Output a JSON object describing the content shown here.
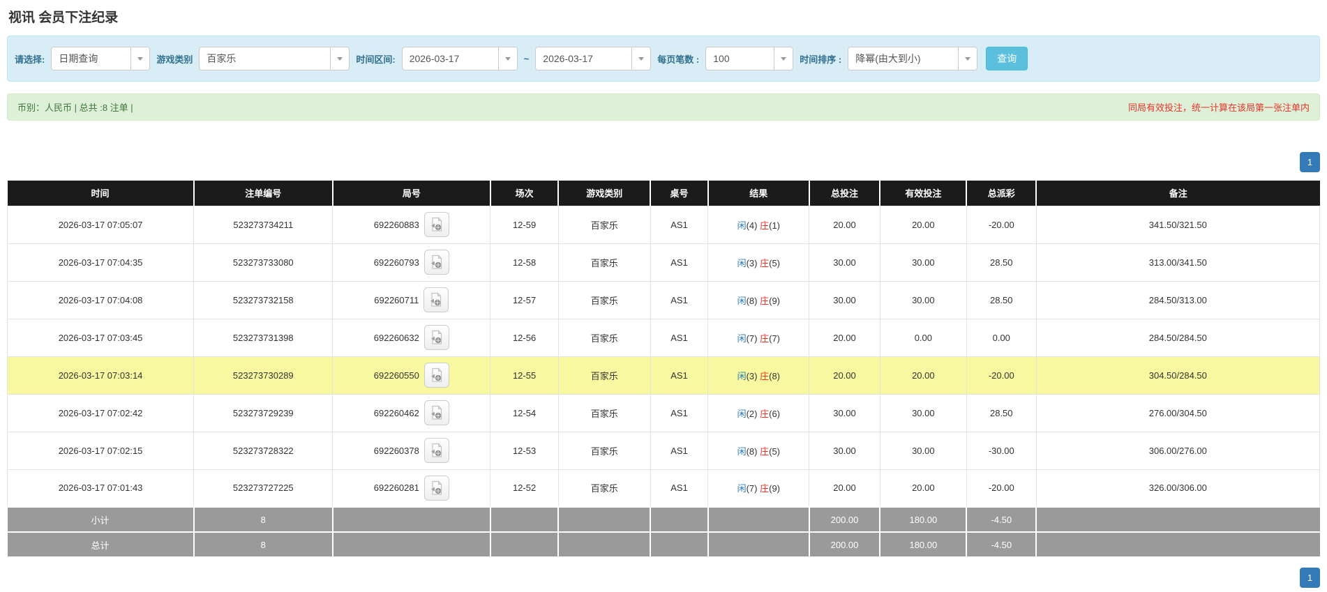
{
  "page_title": "视讯 会员下注纪录",
  "filters": {
    "select_label": "请选择:",
    "select_value": "日期查询",
    "game_type_label": "游戏类别",
    "game_type_value": "百家乐",
    "date_range_label": "时间区间:",
    "date_from": "2026-03-17",
    "date_sep": "~",
    "date_to": "2026-03-17",
    "page_size_label": "每页笔数 :",
    "page_size_value": "100",
    "sort_label": "时间排序 :",
    "sort_value": "降幂(由大到小)",
    "search_button": "查询"
  },
  "info_bar": {
    "left": "币别：人民币 | 总共 :8 注单 |",
    "right": "同局有效投注，统一计算在该局第一张注单内"
  },
  "pagination": {
    "page": "1"
  },
  "table": {
    "headers": [
      "时间",
      "注单编号",
      "局号",
      "场次",
      "游戏类别",
      "桌号",
      "结果",
      "总投注",
      "有效投注",
      "总派彩",
      "备注"
    ],
    "rows": [
      {
        "time": "2026-03-17 07:05:07",
        "bet_id": "523273734211",
        "round_id": "692260883",
        "session": "12-59",
        "game_type": "百家乐",
        "table_no": "AS1",
        "player": "闲",
        "player_score": "(4)",
        "banker": "庄",
        "banker_score": "(1)",
        "total_bet": "20.00",
        "valid_bet": "20.00",
        "payout": "-20.00",
        "remark": "341.50/321.50",
        "highlighted": false
      },
      {
        "time": "2026-03-17 07:04:35",
        "bet_id": "523273733080",
        "round_id": "692260793",
        "session": "12-58",
        "game_type": "百家乐",
        "table_no": "AS1",
        "player": "闲",
        "player_score": "(3)",
        "banker": "庄",
        "banker_score": "(5)",
        "total_bet": "30.00",
        "valid_bet": "30.00",
        "payout": "28.50",
        "remark": "313.00/341.50",
        "highlighted": false
      },
      {
        "time": "2026-03-17 07:04:08",
        "bet_id": "523273732158",
        "round_id": "692260711",
        "session": "12-57",
        "game_type": "百家乐",
        "table_no": "AS1",
        "player": "闲",
        "player_score": "(8)",
        "banker": "庄",
        "banker_score": "(9)",
        "total_bet": "30.00",
        "valid_bet": "30.00",
        "payout": "28.50",
        "remark": "284.50/313.00",
        "highlighted": false
      },
      {
        "time": "2026-03-17 07:03:45",
        "bet_id": "523273731398",
        "round_id": "692260632",
        "session": "12-56",
        "game_type": "百家乐",
        "table_no": "AS1",
        "player": "闲",
        "player_score": "(7)",
        "banker": "庄",
        "banker_score": "(7)",
        "total_bet": "20.00",
        "valid_bet": "0.00",
        "payout": "0.00",
        "remark": "284.50/284.50",
        "highlighted": false
      },
      {
        "time": "2026-03-17 07:03:14",
        "bet_id": "523273730289",
        "round_id": "692260550",
        "session": "12-55",
        "game_type": "百家乐",
        "table_no": "AS1",
        "player": "闲",
        "player_score": "(3)",
        "banker": "庄",
        "banker_score": "(8)",
        "total_bet": "20.00",
        "valid_bet": "20.00",
        "payout": "-20.00",
        "remark": "304.50/284.50",
        "highlighted": true
      },
      {
        "time": "2026-03-17 07:02:42",
        "bet_id": "523273729239",
        "round_id": "692260462",
        "session": "12-54",
        "game_type": "百家乐",
        "table_no": "AS1",
        "player": "闲",
        "player_score": "(2)",
        "banker": "庄",
        "banker_score": "(6)",
        "total_bet": "30.00",
        "valid_bet": "30.00",
        "payout": "28.50",
        "remark": "276.00/304.50",
        "highlighted": false
      },
      {
        "time": "2026-03-17 07:02:15",
        "bet_id": "523273728322",
        "round_id": "692260378",
        "session": "12-53",
        "game_type": "百家乐",
        "table_no": "AS1",
        "player": "闲",
        "player_score": "(8)",
        "banker": "庄",
        "banker_score": "(5)",
        "total_bet": "30.00",
        "valid_bet": "30.00",
        "payout": "-30.00",
        "remark": "306.00/276.00",
        "highlighted": false
      },
      {
        "time": "2026-03-17 07:01:43",
        "bet_id": "523273727225",
        "round_id": "692260281",
        "session": "12-52",
        "game_type": "百家乐",
        "table_no": "AS1",
        "player": "闲",
        "player_score": "(7)",
        "banker": "庄",
        "banker_score": "(9)",
        "total_bet": "20.00",
        "valid_bet": "20.00",
        "payout": "-20.00",
        "remark": "326.00/306.00",
        "highlighted": false
      }
    ],
    "footer_rows": [
      {
        "label": "小计",
        "count": "8",
        "total_bet": "200.00",
        "valid_bet": "180.00",
        "payout": "-4.50"
      },
      {
        "label": "总计",
        "count": "8",
        "total_bet": "200.00",
        "valid_bet": "180.00",
        "payout": "-4.50"
      }
    ]
  },
  "icons": {
    "video_file": "video-file-icon",
    "dropdown": "chevron-down-icon"
  },
  "colors": {
    "panel_bg": "#d9edf7",
    "panel_border": "#bce8f1",
    "label_blue": "#31708f",
    "button_blue": "#5bc0de",
    "info_bg": "#dff0d8",
    "info_text_green": "#3c763d",
    "warning_red": "#e8332a",
    "header_bg": "#1b1b1b",
    "row_highlight": "#f8f8a0",
    "link_blue": "#2a7ab9",
    "negative_red": "#ff0000",
    "summary_bg": "#9a9a9a",
    "pager_blue": "#337ab7"
  }
}
